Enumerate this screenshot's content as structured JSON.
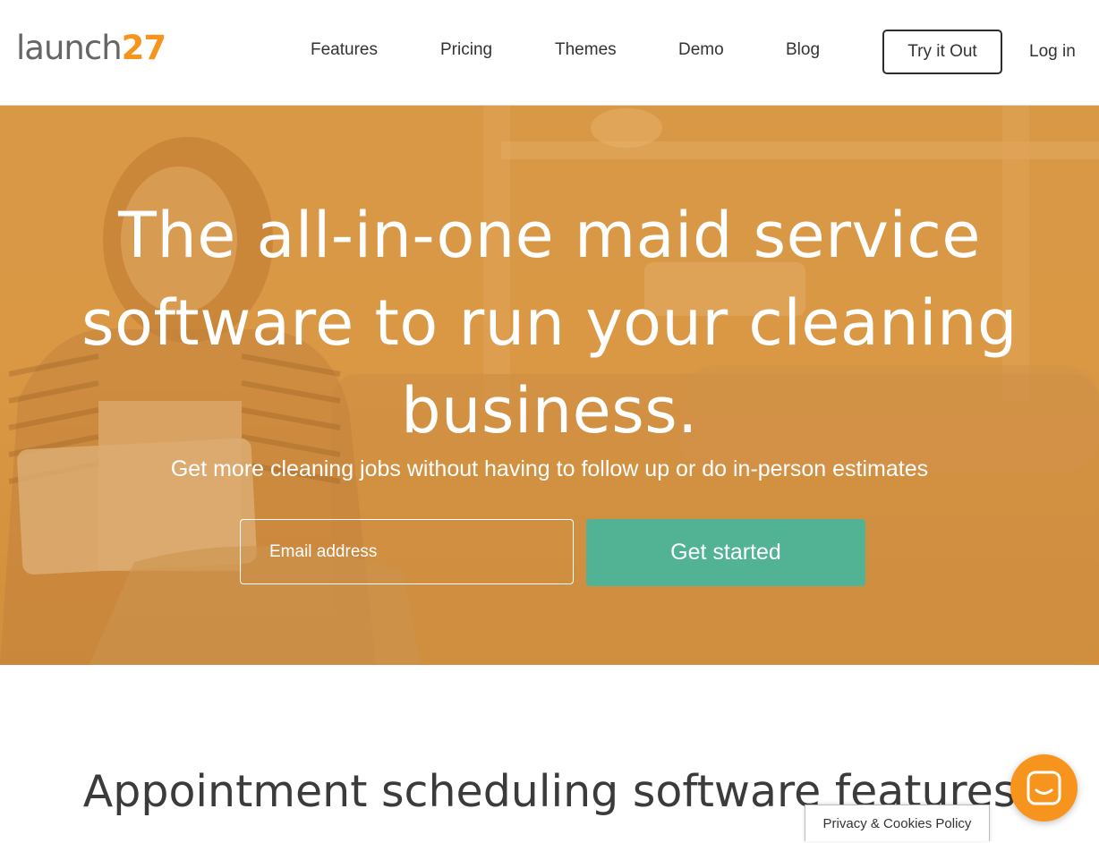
{
  "header": {
    "logo": {
      "word": "launch",
      "number": "27",
      "word_color": "#666666",
      "number_color": "#f7941d"
    },
    "nav": [
      {
        "label": "Features"
      },
      {
        "label": "Pricing"
      },
      {
        "label": "Themes"
      },
      {
        "label": "Demo"
      },
      {
        "label": "Blog"
      }
    ],
    "try_button": "Try it Out",
    "login": "Log in"
  },
  "hero": {
    "title_line1": "The all-in-one maid service",
    "title_line2": "software to run your cleaning",
    "title_line3": "business.",
    "subtitle": "Get more cleaning jobs without having to follow up or do in-person estimates",
    "email_placeholder": "Email address",
    "cta": "Get started",
    "overlay_color": "#d99a4a",
    "cta_color": "#52b394"
  },
  "section": {
    "heading": "Appointment scheduling software features"
  },
  "cookie_tab": "Privacy & Cookies Policy",
  "chat": {
    "icon": "chat-bubble-icon",
    "color": "#f7941d"
  }
}
